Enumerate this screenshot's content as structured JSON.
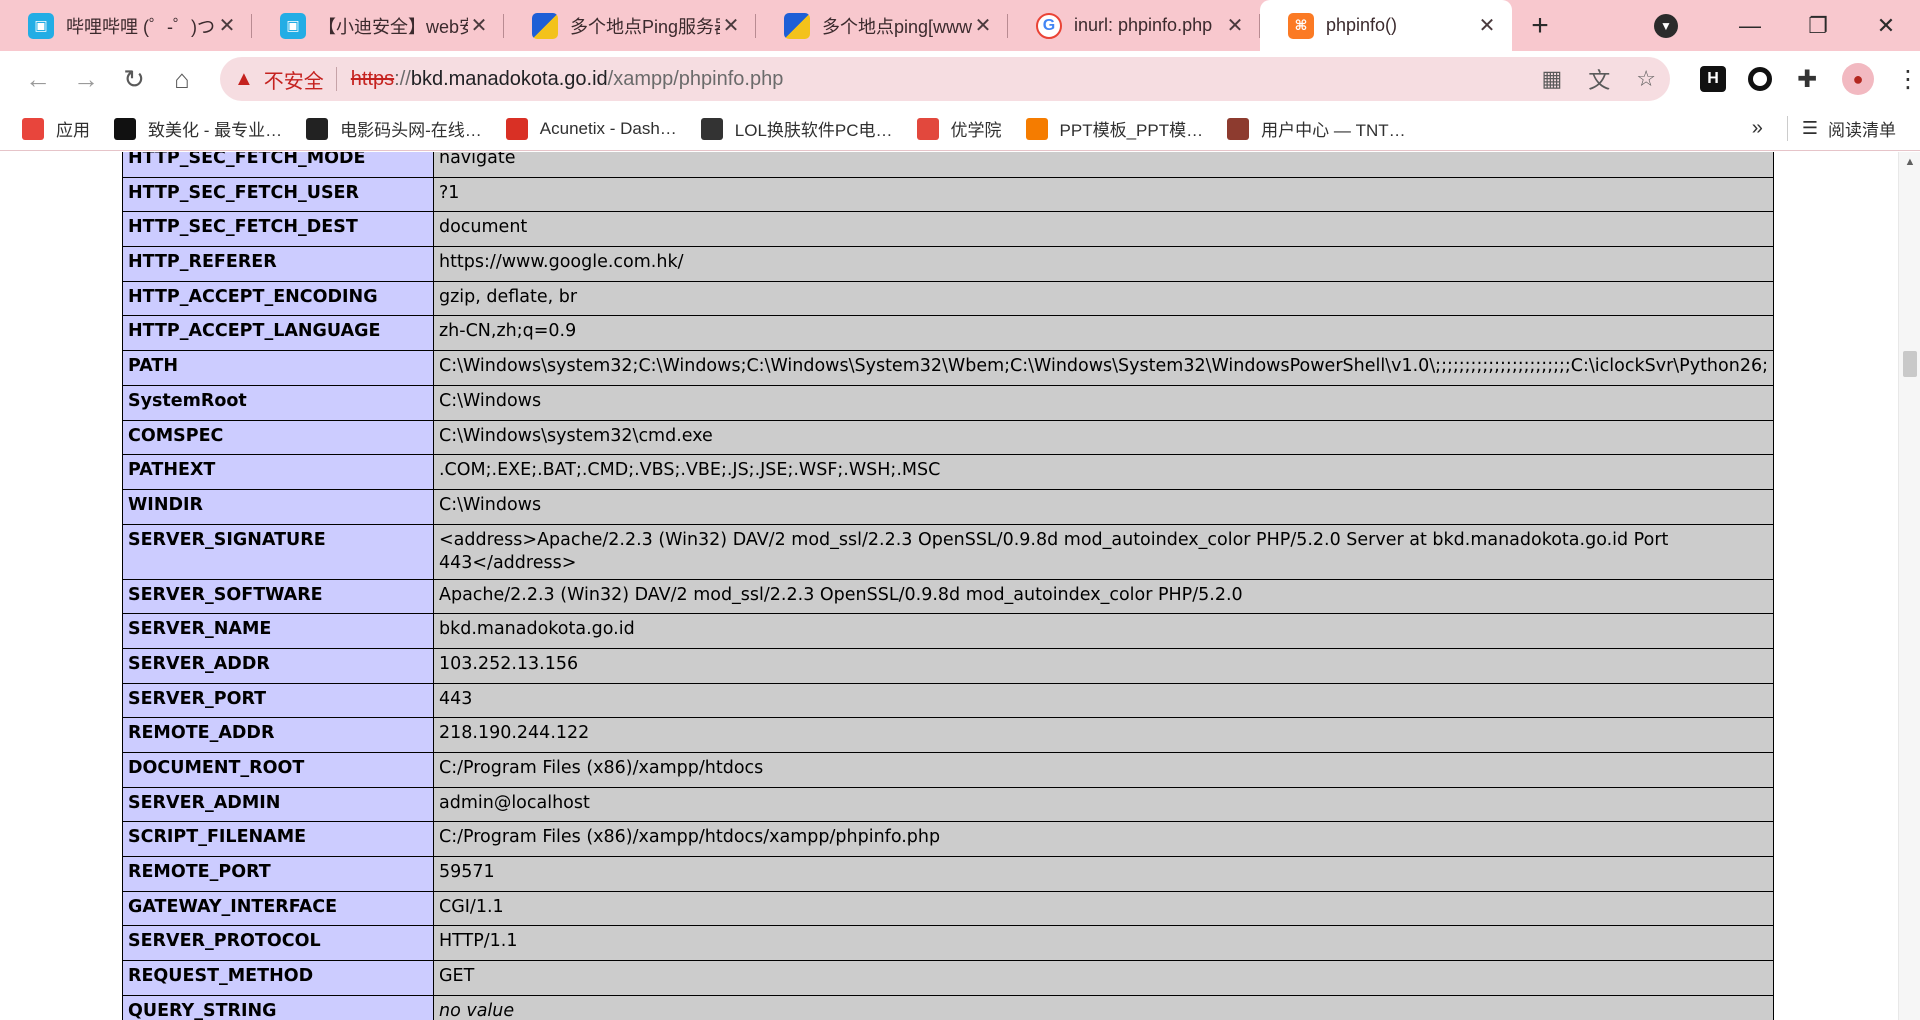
{
  "tabs": [
    {
      "title": "哔哩哔哩 (゜-゜)つ",
      "icon": "bilibili-icon",
      "active": false
    },
    {
      "title": "【小迪安全】web安",
      "icon": "bilibili-icon",
      "active": false
    },
    {
      "title": "多个地点Ping服务器",
      "icon": "ping-site-icon",
      "active": false
    },
    {
      "title": "多个地点ping[www",
      "icon": "ping-site-icon",
      "active": false
    },
    {
      "title": "inurl: phpinfo.php",
      "icon": "google-icon",
      "active": false
    },
    {
      "title": "phpinfo()",
      "icon": "xampp-icon",
      "active": true
    }
  ],
  "omnibox": {
    "security_label": "不安全",
    "url_scheme": "https",
    "url_sep": "://",
    "url_host": "bkd.manadokota.go.id",
    "url_path": "/xampp/phpinfo.php"
  },
  "bookmarks": [
    {
      "label": "应用",
      "icon": "apps-grid-icon",
      "color": "#e8453c"
    },
    {
      "label": "致美化 - 最专业…",
      "icon": "zhimeihua-icon",
      "color": "#111111"
    },
    {
      "label": "电影码头网-在线…",
      "icon": "film-icon",
      "color": "#222222"
    },
    {
      "label": "Acunetix - Dash…",
      "icon": "acunetix-icon",
      "color": "#d93025"
    },
    {
      "label": "LOL换肤软件PC电…",
      "icon": "lol-icon",
      "color": "#333333"
    },
    {
      "label": "优学院",
      "icon": "youxueyuan-icon",
      "color": "#e2483d"
    },
    {
      "label": "PPT模板_PPT模…",
      "icon": "ppt-icon",
      "color": "#f57c00"
    },
    {
      "label": "用户中心 — TNT…",
      "icon": "tnt-icon",
      "color": "#8d3b2f"
    }
  ],
  "bookmarks_more": "»",
  "reading_list_label": "阅读清单",
  "table_rows": [
    {
      "key": "HTTP_SEC_FETCH_MODE",
      "value": "navigate"
    },
    {
      "key": "HTTP_SEC_FETCH_USER",
      "value": "?1"
    },
    {
      "key": "HTTP_SEC_FETCH_DEST",
      "value": "document"
    },
    {
      "key": "HTTP_REFERER",
      "value": "https://www.google.com.hk/"
    },
    {
      "key": "HTTP_ACCEPT_ENCODING",
      "value": "gzip, deflate, br"
    },
    {
      "key": "HTTP_ACCEPT_LANGUAGE",
      "value": "zh-CN,zh;q=0.9"
    },
    {
      "key": "PATH",
      "value": "C:\\Windows\\system32;C:\\Windows;C:\\Windows\\System32\\Wbem;C:\\Windows\\System32\\WindowsPowerShell\\v1.0\\;;;;;;;;;;;;;;;;;;;;;;;C:\\iclockSvr\\Python26;"
    },
    {
      "key": "SystemRoot",
      "value": "C:\\Windows"
    },
    {
      "key": "COMSPEC",
      "value": "C:\\Windows\\system32\\cmd.exe"
    },
    {
      "key": "PATHEXT",
      "value": ".COM;.EXE;.BAT;.CMD;.VBS;.VBE;.JS;.JSE;.WSF;.WSH;.MSC"
    },
    {
      "key": "WINDIR",
      "value": "C:\\Windows"
    },
    {
      "key": "SERVER_SIGNATURE",
      "value": "<address>Apache/2.2.3 (Win32) DAV/2 mod_ssl/2.2.3 OpenSSL/0.9.8d mod_autoindex_color PHP/5.2.0 Server at bkd.manadokota.go.id Port 443</address>"
    },
    {
      "key": "SERVER_SOFTWARE",
      "value": "Apache/2.2.3 (Win32) DAV/2 mod_ssl/2.2.3 OpenSSL/0.9.8d mod_autoindex_color PHP/5.2.0"
    },
    {
      "key": "SERVER_NAME",
      "value": "bkd.manadokota.go.id"
    },
    {
      "key": "SERVER_ADDR",
      "value": "103.252.13.156"
    },
    {
      "key": "SERVER_PORT",
      "value": "443"
    },
    {
      "key": "REMOTE_ADDR",
      "value": "218.190.244.122"
    },
    {
      "key": "DOCUMENT_ROOT",
      "value": "C:/Program Files (x86)/xampp/htdocs"
    },
    {
      "key": "SERVER_ADMIN",
      "value": "admin@localhost"
    },
    {
      "key": "SCRIPT_FILENAME",
      "value": "C:/Program Files (x86)/xampp/htdocs/xampp/phpinfo.php"
    },
    {
      "key": "REMOTE_PORT",
      "value": "59571"
    },
    {
      "key": "GATEWAY_INTERFACE",
      "value": "CGI/1.1"
    },
    {
      "key": "SERVER_PROTOCOL",
      "value": "HTTP/1.1"
    },
    {
      "key": "REQUEST_METHOD",
      "value": "GET"
    },
    {
      "key": "QUERY_STRING",
      "value": "no value",
      "italic": true
    }
  ],
  "colors": {
    "tabstrip_bg": "#f8c8ce",
    "omnibox_bg": "#f6dde1",
    "insecure": "#c5221f",
    "key_cell_bg": "#ccccff",
    "value_cell_bg": "#cccccc"
  }
}
